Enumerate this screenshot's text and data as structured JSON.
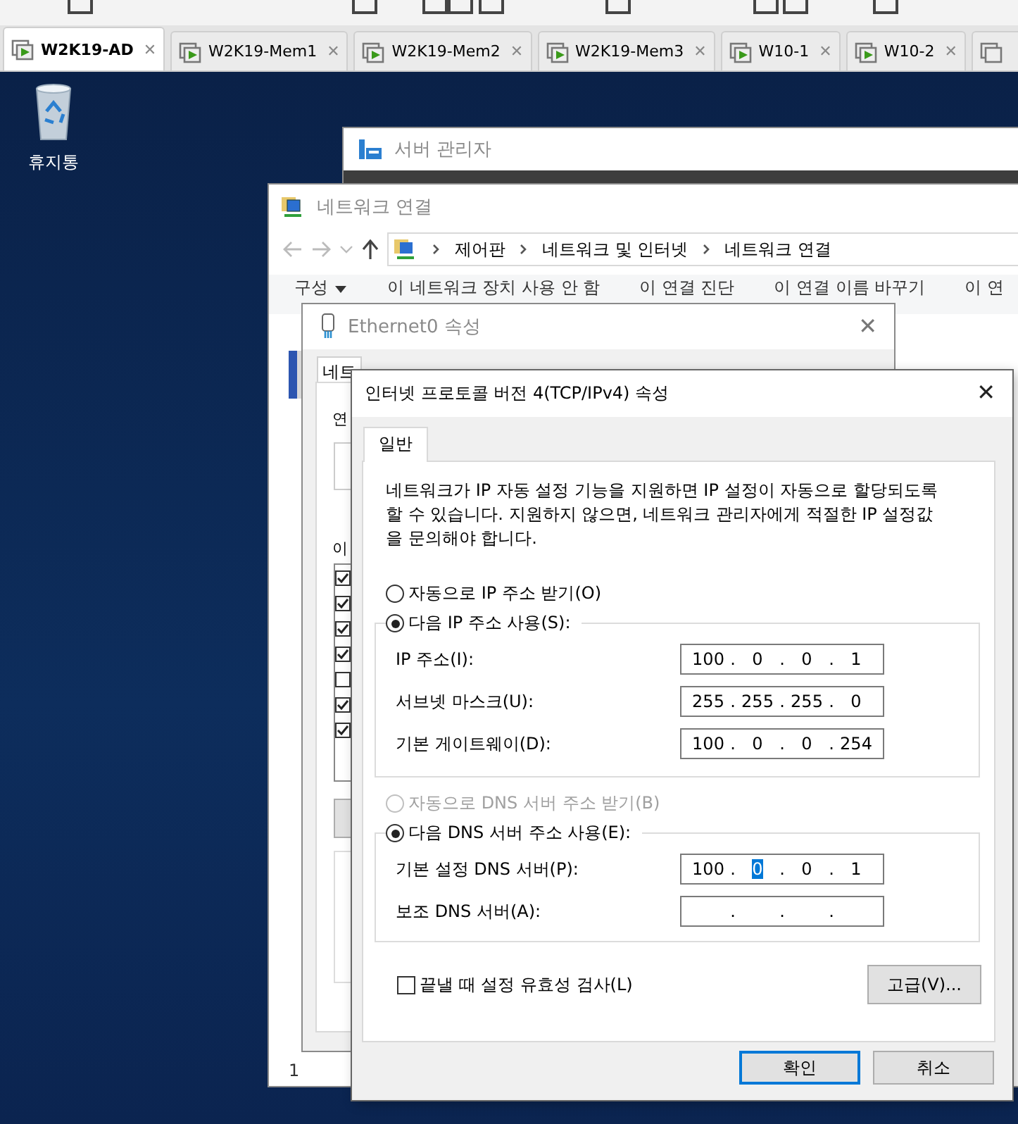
{
  "vm_tabs": [
    {
      "label": "W2K19-AD",
      "selected": true
    },
    {
      "label": "W2K19-Mem1",
      "selected": false
    },
    {
      "label": "W2K19-Mem2",
      "selected": false
    },
    {
      "label": "W2K19-Mem3",
      "selected": false
    },
    {
      "label": "W10-1",
      "selected": false
    },
    {
      "label": "W10-2",
      "selected": false
    }
  ],
  "close_glyph": "✕",
  "desktop": {
    "icons": [
      {
        "label": "휴지통"
      }
    ]
  },
  "server_manager": {
    "title": "서버 관리자"
  },
  "network_connections": {
    "title": "네트워크 연결",
    "breadcrumb": [
      "제어판",
      "네트워크 및 인터넷",
      "네트워크 연결"
    ],
    "commands": [
      {
        "label": "구성",
        "dropdown": true
      },
      {
        "label": "이 네트워크 장치 사용 안 함",
        "dropdown": false
      },
      {
        "label": "이 연결 진단",
        "dropdown": false
      },
      {
        "label": "이 연결 이름 바꾸기",
        "dropdown": false
      },
      {
        "label": "이 연",
        "dropdown": false
      }
    ],
    "status": "1"
  },
  "ethernet_properties": {
    "title": "Ethernet0 속성",
    "tabs": [
      {
        "label": "네트",
        "selected": true
      }
    ],
    "label_1": "연",
    "label_2": "이",
    "components": [
      {
        "checked": true
      },
      {
        "checked": true
      },
      {
        "checked": true
      },
      {
        "checked": true
      },
      {
        "checked": false
      },
      {
        "checked": true
      },
      {
        "checked": true
      }
    ]
  },
  "ipv4_dialog": {
    "title": "인터넷 프로토콜 버전 4(TCP/IPv4) 속성",
    "tabs": [
      {
        "label": "일반",
        "selected": true
      }
    ],
    "description": "네트워크가 IP 자동 설정 기능을 지원하면 IP 설정이 자동으로 할당되도록 할 수 있습니다. 지원하지 않으면, 네트워크 관리자에게 적절한 IP 설정값을 문의해야 합니다.",
    "separator": ".",
    "ip_auto": {
      "label": "자동으로 IP 주소 받기(O)",
      "selected": false,
      "disabled": false
    },
    "ip_manual": {
      "label": "다음 IP 주소 사용(S):",
      "selected": true,
      "disabled": false
    },
    "ip_fields": [
      {
        "label": "IP 주소(I):",
        "octets": [
          {
            "text": "100",
            "selected": false
          },
          {
            "text": "0",
            "selected": false
          },
          {
            "text": "0",
            "selected": false
          },
          {
            "text": "1",
            "selected": false
          }
        ]
      },
      {
        "label": "서브넷 마스크(U):",
        "octets": [
          {
            "text": "255",
            "selected": false
          },
          {
            "text": "255",
            "selected": false
          },
          {
            "text": "255",
            "selected": false
          },
          {
            "text": "0",
            "selected": false
          }
        ]
      },
      {
        "label": "기본 게이트웨이(D):",
        "octets": [
          {
            "text": "100",
            "selected": false
          },
          {
            "text": "0",
            "selected": false
          },
          {
            "text": "0",
            "selected": false
          },
          {
            "text": "254",
            "selected": false
          }
        ]
      }
    ],
    "dns_auto": {
      "label": "자동으로 DNS 서버 주소 받기(B)",
      "selected": false,
      "disabled": true
    },
    "dns_manual": {
      "label": "다음 DNS 서버 주소 사용(E):",
      "selected": true,
      "disabled": false
    },
    "dns_fields": [
      {
        "label": "기본 설정 DNS 서버(P):",
        "octets": [
          {
            "text": "100",
            "selected": false
          },
          {
            "text": "0",
            "selected": true
          },
          {
            "text": "0",
            "selected": false
          },
          {
            "text": "1",
            "selected": false
          }
        ]
      },
      {
        "label": "보조 DNS 서버(A):"
      }
    ],
    "validate": {
      "label": "끝낼 때 설정 유효성 검사(L)",
      "checked": false
    },
    "advanced_button": "고급(V)...",
    "buttons": [
      {
        "label": "확인",
        "default": true
      },
      {
        "label": "취소",
        "default": false
      }
    ]
  }
}
